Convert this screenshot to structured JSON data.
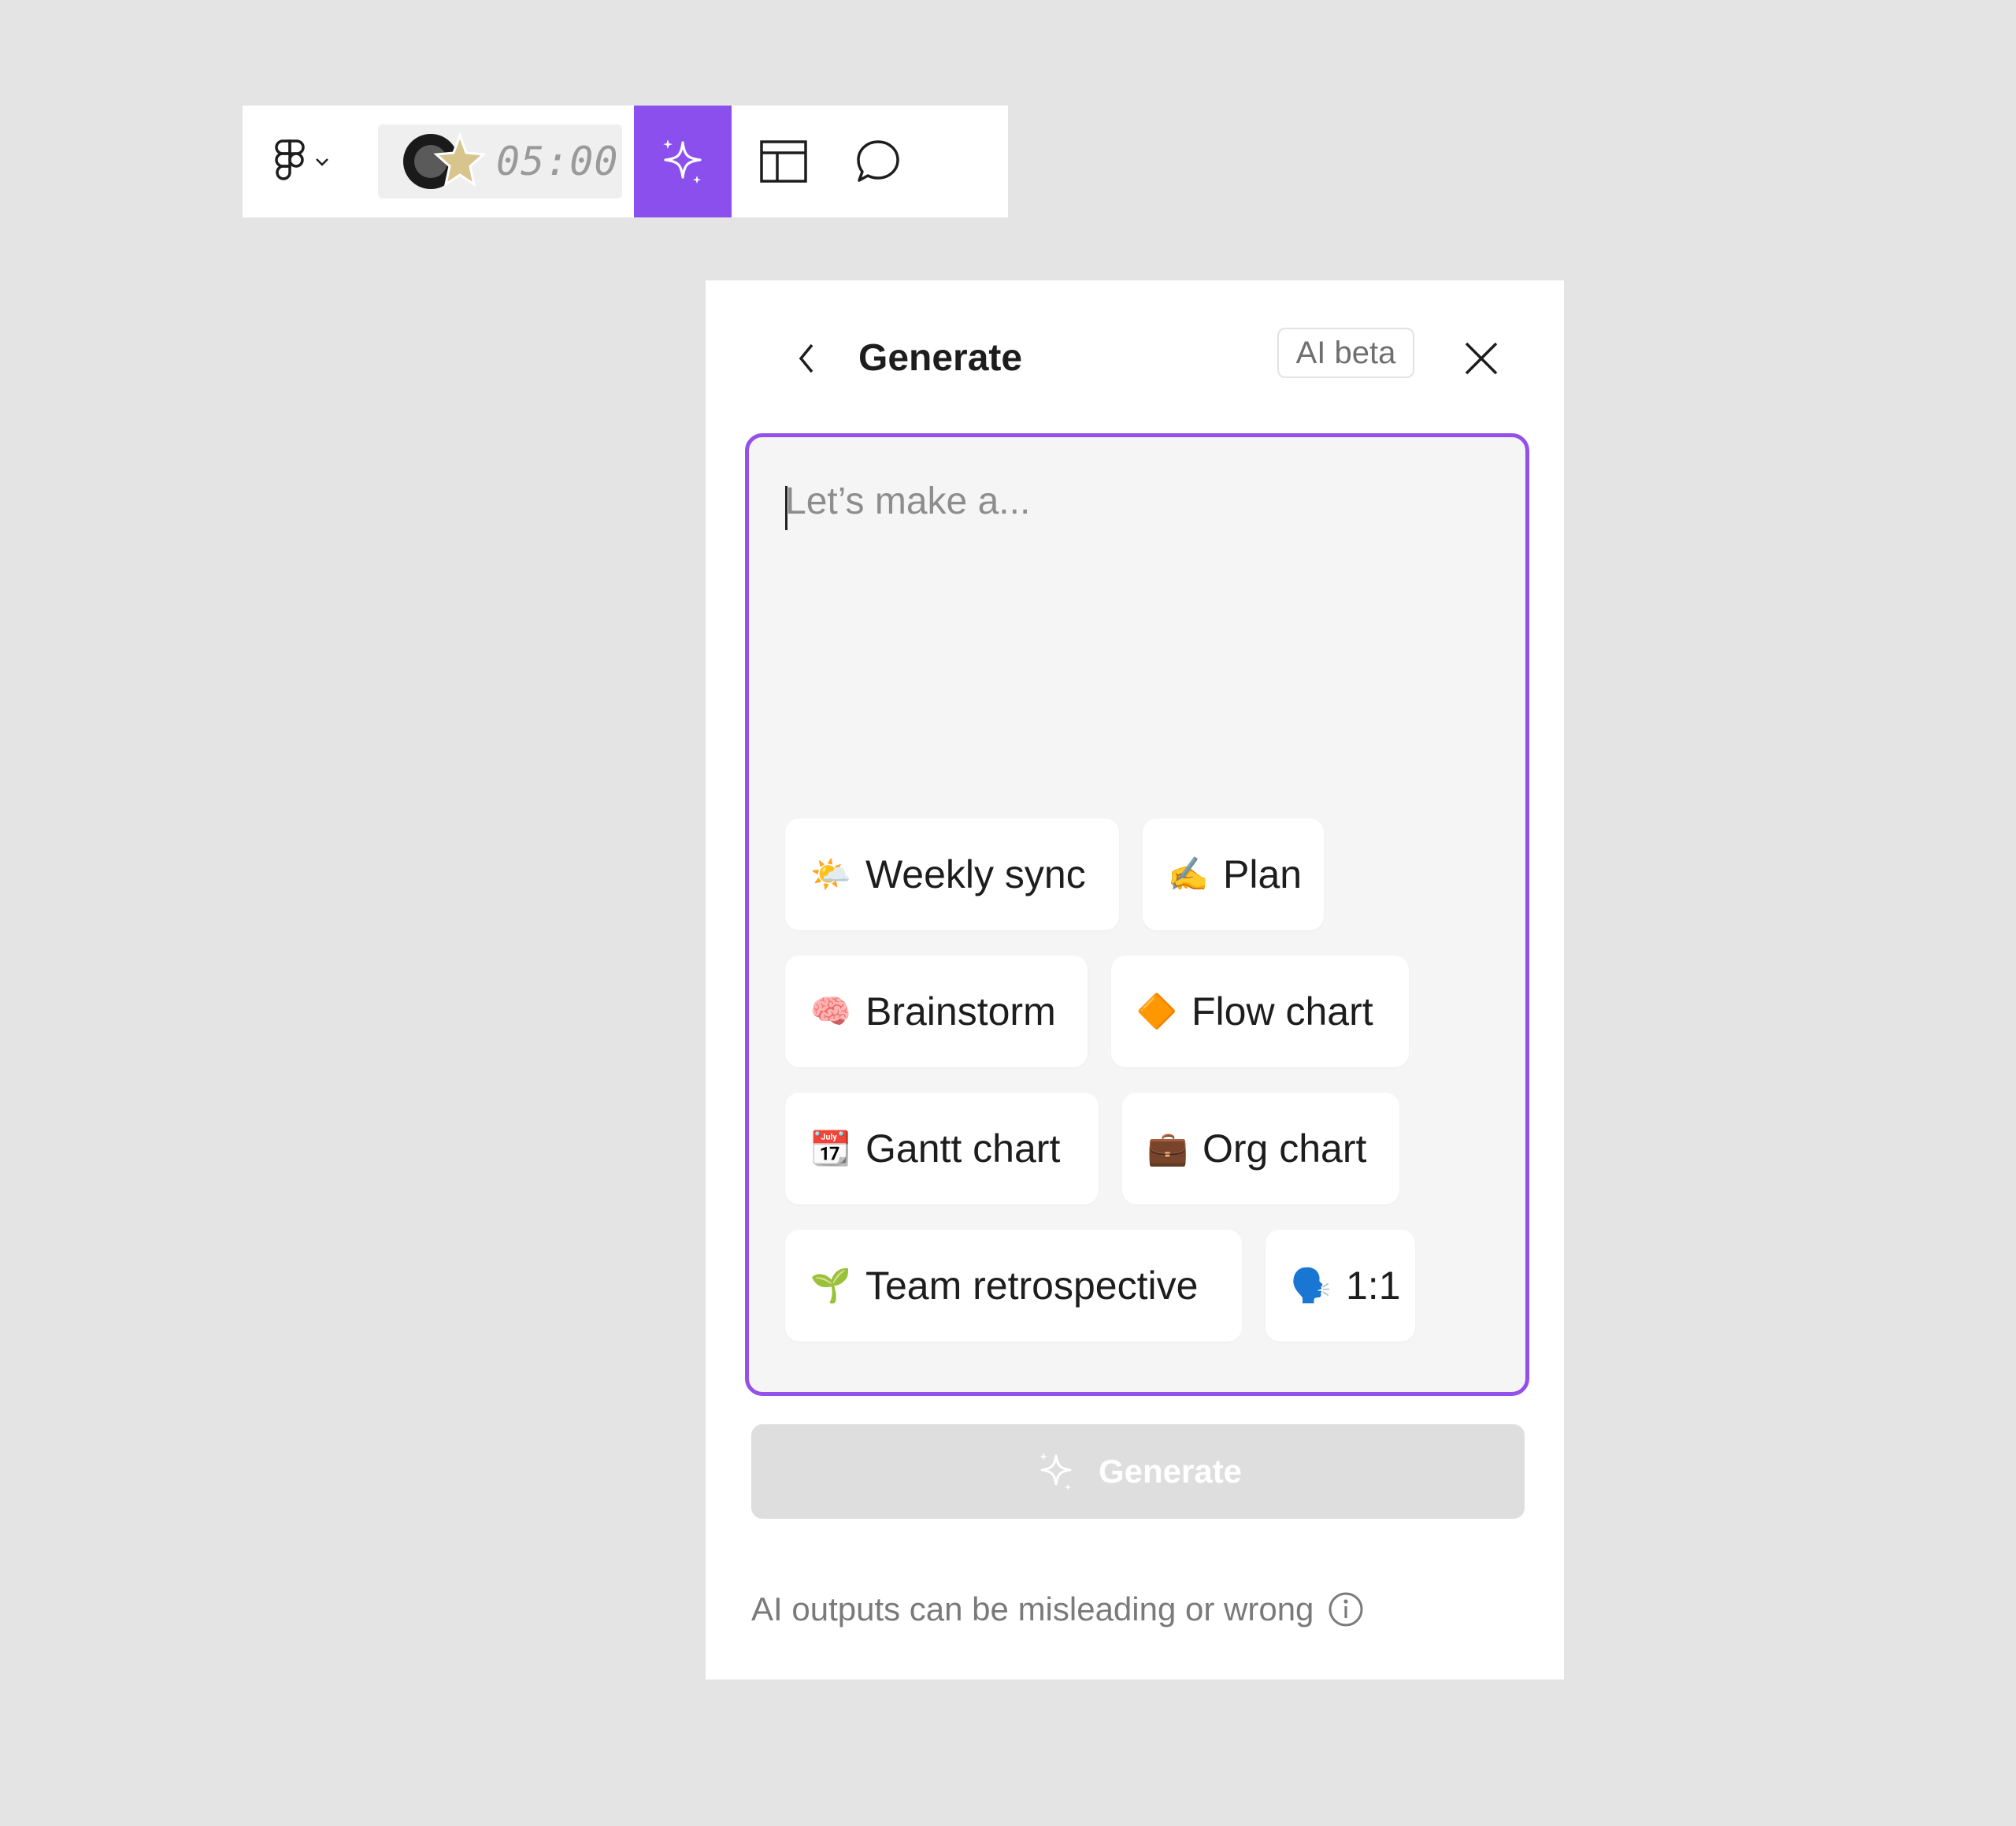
{
  "toolbar": {
    "main_menu_icon": "figma-logo-icon",
    "timer": {
      "time": "05:00"
    },
    "tools": [
      {
        "name": "ai-sparkle",
        "active": true,
        "color": "#8b4fee"
      },
      {
        "name": "layout-template"
      },
      {
        "name": "comment"
      }
    ]
  },
  "panel": {
    "title": "Generate",
    "badge": "AI beta",
    "prompt": {
      "placeholder": "Let’s make a...",
      "value": "",
      "border_color": "#9350ea"
    },
    "suggestions": [
      {
        "emoji": "🌤️",
        "label": "Weekly sync"
      },
      {
        "emoji": "✍️",
        "label": "Plan"
      },
      {
        "emoji": "🧠",
        "label": "Brainstorm"
      },
      {
        "emoji": "🔶",
        "label": "Flow chart"
      },
      {
        "emoji": "📆",
        "label": "Gantt chart"
      },
      {
        "emoji": "💼",
        "label": "Org chart"
      },
      {
        "emoji": "🌱",
        "label": "Team retrospective"
      },
      {
        "emoji": "🗣️",
        "label": "1:1"
      }
    ],
    "generate_button": {
      "label": "Generate",
      "enabled": false
    },
    "disclaimer": "AI outputs can be misleading or wrong"
  }
}
